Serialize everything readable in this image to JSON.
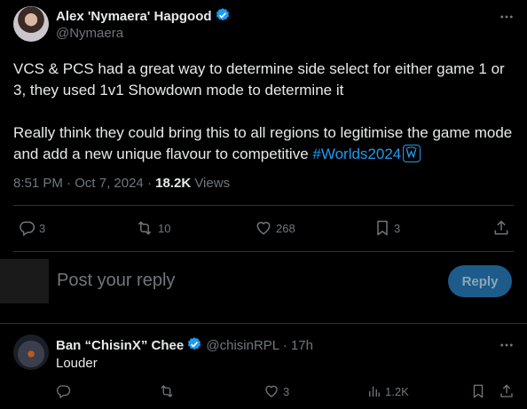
{
  "tweet": {
    "author_name": "Alex 'Nymaera' Hapgood",
    "author_handle": "@Nymaera",
    "paragraph1": "VCS & PCS had a great way to determine side select for either game 1 or 3, they used 1v1 Showdown mode to determine it",
    "paragraph2": "Really think they could bring this to all regions to legitimise the game mode and add a new unique flavour to competitive ",
    "hashtag": "#Worlds2024",
    "time": "8:51 PM",
    "date": "Oct 7, 2024",
    "separator": "·",
    "views_count": "18.2K",
    "views_label": "Views",
    "replies": "3",
    "reposts": "10",
    "likes": "268",
    "bookmarks": "3"
  },
  "composer": {
    "placeholder": "Post your reply",
    "button_label": "Reply"
  },
  "reply": {
    "author_name": "Ban “ChisinX” Chee",
    "author_handle": "@chisinRPL",
    "separator": "·",
    "age": "17h",
    "text": "Louder",
    "replies": "",
    "reposts": "",
    "likes": "3",
    "views": "1.2K"
  },
  "colors": {
    "background": "#000000",
    "text": "#e7e9ea",
    "muted": "#71767b",
    "accent": "#1d9bf0",
    "divider": "#2f3336"
  }
}
